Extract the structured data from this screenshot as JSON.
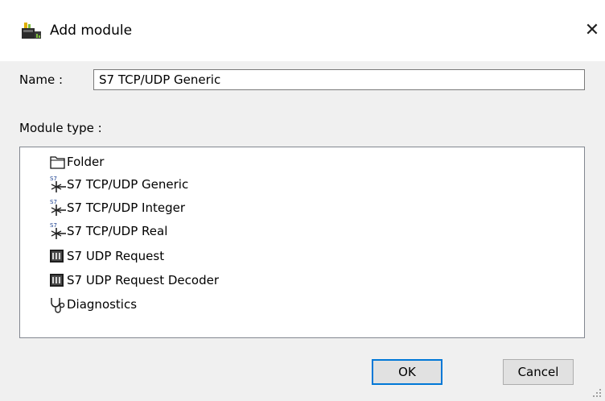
{
  "dialog": {
    "title": "Add module",
    "close_glyph": "✕"
  },
  "name_field": {
    "label": "Name :",
    "value": "S7 TCP/UDP Generic"
  },
  "module_type": {
    "label": "Module type :",
    "items": [
      {
        "label": "Folder",
        "icon": "folder-icon"
      },
      {
        "label": "S7 TCP/UDP Generic",
        "icon": "s7-network-icon"
      },
      {
        "label": "S7 TCP/UDP Integer",
        "icon": "s7-network-icon"
      },
      {
        "label": "S7 TCP/UDP Real",
        "icon": "s7-network-icon"
      },
      {
        "label": "S7 UDP Request",
        "icon": "module-block-icon"
      },
      {
        "label": "S7 UDP Request Decoder",
        "icon": "module-block-icon"
      },
      {
        "label": "Diagnostics",
        "icon": "stethoscope-icon"
      }
    ]
  },
  "buttons": {
    "ok": "OK",
    "cancel": "Cancel"
  },
  "colors": {
    "accent": "#0078d7",
    "dialog_bg": "#f0f0f0"
  }
}
